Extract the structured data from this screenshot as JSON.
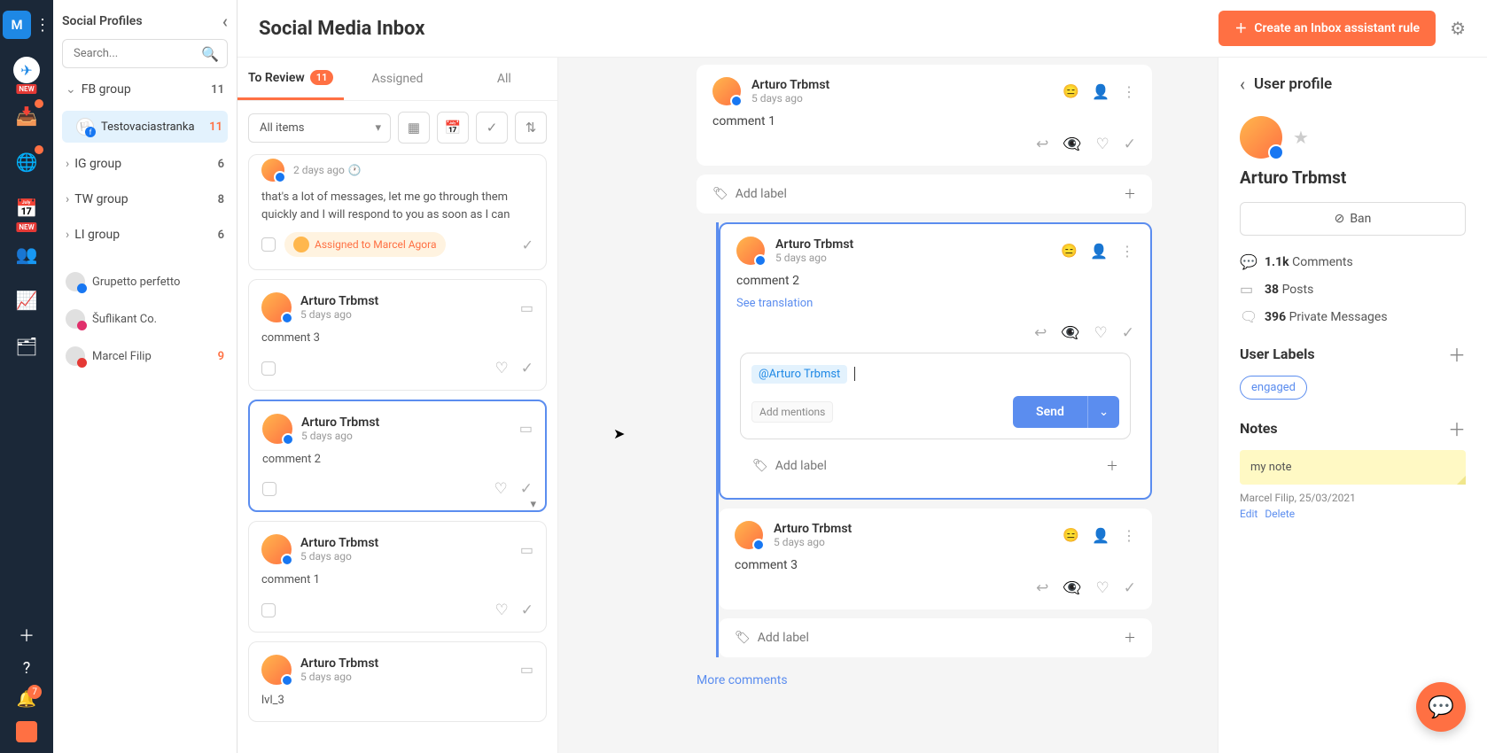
{
  "rail": {
    "avatar_letter": "M",
    "notif_count": "7"
  },
  "profiles": {
    "title": "Social Profiles",
    "search_placeholder": "Search...",
    "groups": [
      {
        "name": "FB group",
        "count": "11",
        "expanded": true
      },
      {
        "name": "IG group",
        "count": "6"
      },
      {
        "name": "TW group",
        "count": "8"
      },
      {
        "name": "LI group",
        "count": "6"
      }
    ],
    "fb_sub": {
      "name": "Testovaciastranka",
      "count": "11"
    },
    "entries": [
      {
        "name": "Grupetto perfetto",
        "count": ""
      },
      {
        "name": "Šuflikant Co.",
        "count": ""
      },
      {
        "name": "Marcel Filip",
        "count": "9"
      }
    ]
  },
  "header": {
    "title": "Social Media Inbox",
    "create_btn": "Create an Inbox assistant rule"
  },
  "tabs": {
    "review": "To Review",
    "review_count": "11",
    "assigned": "Assigned",
    "all": "All"
  },
  "filter": {
    "all_items": "All items"
  },
  "inbox": {
    "card0": {
      "time": "2 days ago",
      "body": "that's a lot of messages, let me go through them quickly and I will respond to you as soon as I can",
      "assigned": "Assigned to Marcel Agora"
    },
    "card1": {
      "name": "Arturo Trbmst",
      "time": "5 days ago",
      "body": "comment 3"
    },
    "card2": {
      "name": "Arturo Trbmst",
      "time": "5 days ago",
      "body": "comment 2"
    },
    "card3": {
      "name": "Arturo Trbmst",
      "time": "5 days ago",
      "body": "comment 1"
    },
    "card4": {
      "name": "Arturo Trbmst",
      "time": "5 days ago",
      "body": "lvl_3"
    }
  },
  "detail": {
    "c1": {
      "name": "Arturo Trbmst",
      "time": "5 days ago",
      "body": "comment 1"
    },
    "c2": {
      "name": "Arturo Trbmst",
      "time": "5 days ago",
      "body": "comment 2",
      "translate": "See translation"
    },
    "c3": {
      "name": "Arturo Trbmst",
      "time": "5 days ago",
      "body": "comment 3"
    },
    "add_label": "Add label",
    "mention": "@Arturo Trbmst",
    "add_mentions": "Add mentions",
    "send": "Send",
    "more": "More comments"
  },
  "user": {
    "back_title": "User profile",
    "name": "Arturo Trbmst",
    "ban": "Ban",
    "stat_comments_n": "1.1k",
    "stat_comments": "Comments",
    "stat_posts_n": "38",
    "stat_posts": "Posts",
    "stat_pm_n": "396",
    "stat_pm": "Private Messages",
    "labels_title": "User Labels",
    "label_engaged": "engaged",
    "notes_title": "Notes",
    "note_body": "my note",
    "note_meta": "Marcel Filip, 25/03/2021",
    "note_edit": "Edit",
    "note_delete": "Delete"
  }
}
